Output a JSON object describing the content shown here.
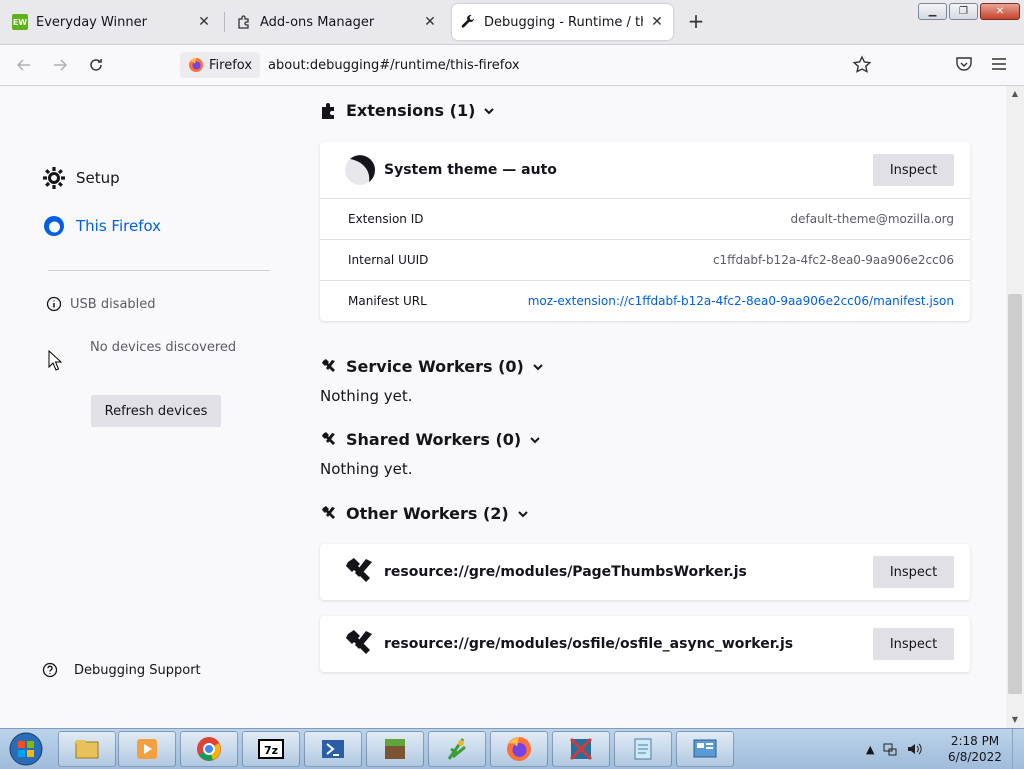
{
  "tabs": [
    {
      "label": "Everyday Winner",
      "favicon": "ew-favicon",
      "favicon_text": "EW"
    },
    {
      "label": "Add-ons Manager",
      "favicon": "puzzle-icon"
    },
    {
      "label": "Debugging - Runtime / this-firefox",
      "favicon": "wrench-icon",
      "active": true
    }
  ],
  "navbar": {
    "identity_label": "Firefox",
    "url": "about:debugging#/runtime/this-firefox"
  },
  "sidebar": {
    "setup_label": "Setup",
    "this_firefox_label": "This Firefox",
    "usb_status": "USB disabled",
    "no_devices": "No devices discovered",
    "refresh_label": "Refresh devices",
    "support_label": "Debugging Support"
  },
  "extensions": {
    "heading": "Extensions (1)",
    "card": {
      "title": "System theme — auto",
      "inspect_label": "Inspect",
      "rows": [
        {
          "key": "Extension ID",
          "value": "default-theme@mozilla.org"
        },
        {
          "key": "Internal UUID",
          "value": "c1ffdabf-b12a-4fc2-8ea0-9aa906e2cc06"
        },
        {
          "key": "Manifest URL",
          "value": "moz-extension://c1ffdabf-b12a-4fc2-8ea0-9aa906e2cc06/manifest.json"
        }
      ]
    }
  },
  "service_workers": {
    "heading": "Service Workers (0)",
    "empty": "Nothing yet."
  },
  "shared_workers": {
    "heading": "Shared Workers (0)",
    "empty": "Nothing yet."
  },
  "other_workers": {
    "heading": "Other Workers (2)",
    "items": [
      {
        "title": "resource://gre/modules/PageThumbsWorker.js",
        "inspect_label": "Inspect"
      },
      {
        "title": "resource://gre/modules/osfile/osfile_async_worker.js",
        "inspect_label": "Inspect"
      }
    ]
  },
  "taskbar": {
    "apps": [
      "explorer-icon",
      "media-player-icon",
      "chrome-icon",
      "7zip-icon",
      "powershell-icon",
      "minecraft-icon",
      "plant-app-icon",
      "firefox-icon",
      "app-icon",
      "notepad-icon",
      "control-panel-icon"
    ],
    "sevenzip_text": "7z",
    "time": "2:18 PM",
    "date": "6/8/2022"
  },
  "colors": {
    "accent": "#0060df",
    "button_bg": "#e0e0e6",
    "page_bg": "#f9f9fb"
  }
}
